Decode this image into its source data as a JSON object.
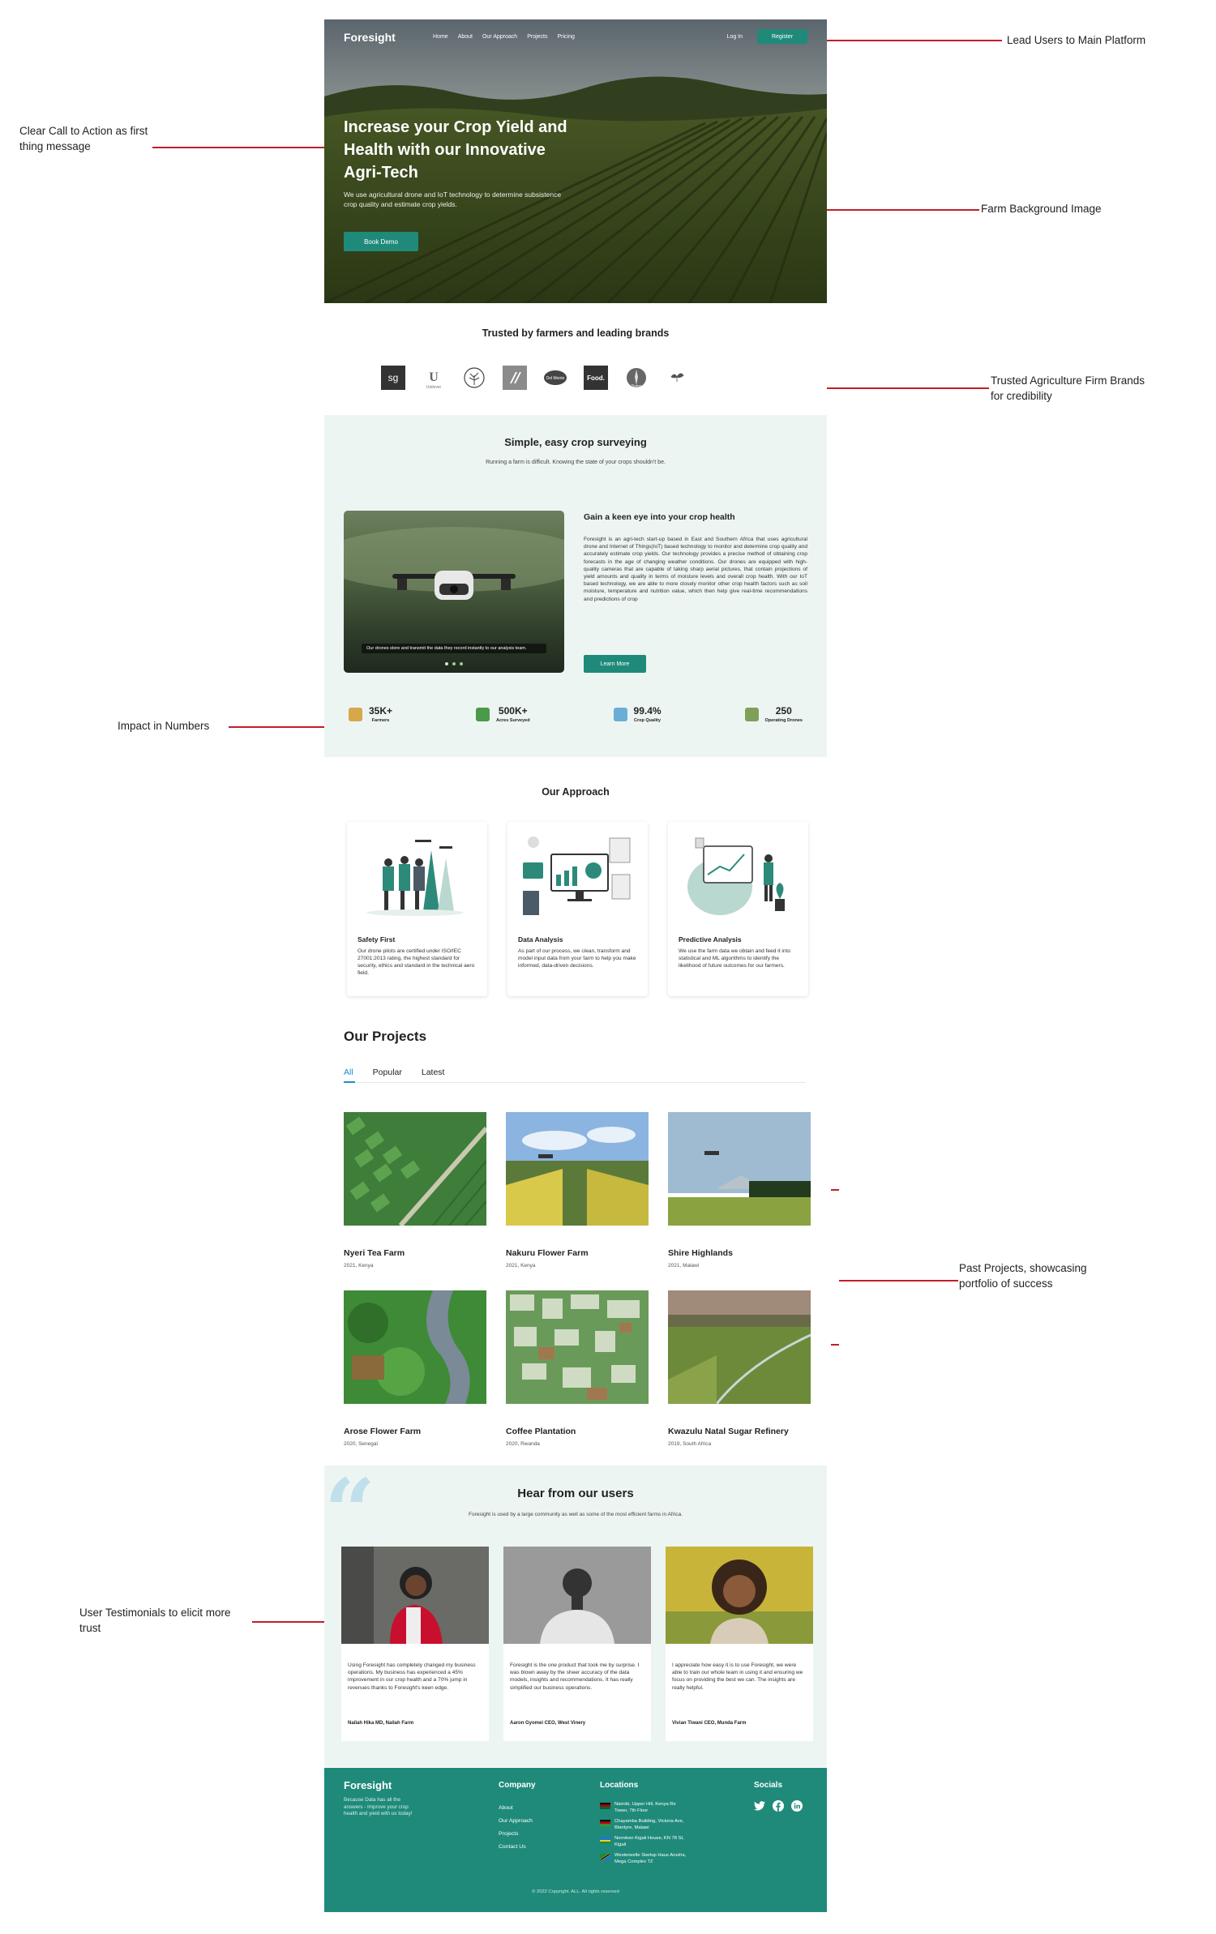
{
  "annotations": {
    "lead_users": "Lead Users to Main Platform",
    "cta_line1": "Clear Call to Action as first",
    "cta_line2": "thing message",
    "farm_bg": "Farm Background Image",
    "brands_line1": "Trusted Agriculture Firm Brands",
    "brands_line2": "for credibility",
    "impact": "Impact in Numbers",
    "past_line1": "Past Projects, showcasing",
    "past_line2": "portfolio of success",
    "testi_line1": "User Testimonials to elicit more",
    "testi_line2": "trust"
  },
  "nav": {
    "logo": "Foresight",
    "links": [
      "Home",
      "About",
      "Our Approach",
      "Projects",
      "Pricing"
    ],
    "login": "Log In",
    "register": "Register"
  },
  "hero": {
    "title": "Increase your Crop Yield and Health with our Innovative Agri-Tech",
    "text": "We use agricultural drone and IoT technology to determine subsistence crop quality and estimate crop yields.",
    "cta": "Book Demo"
  },
  "trusted": {
    "title": "Trusted by farmers and leading brands",
    "brands": [
      "sg",
      "Unilever",
      "tree",
      "brand-4",
      "Del Monte",
      "Food.",
      "Twiga",
      "leaf"
    ]
  },
  "survey": {
    "title": "Simple, easy crop surveying",
    "subtitle": "Running a farm is difficult. Knowing the state of your crops shouldn't be.",
    "caption": "Our drones store and transmit the data they record instantly to our analysis team.",
    "heading": "Gain a keen eye into your crop health",
    "body": "Foresight is an agri-tech start-up based in East and Southern Africa that uses agricultural drone and Internet of Things(IoT) based technology to monitor and determine crop quality and accurately estimate crop yields. Our technology provides a precise method of obtaining crop forecasts in the age of changing weather conditions. Our drones are equipped with high-quality cameras that are capable of taking sharp aerial pictures, that contain projections of yield amounts and quality in terms of moisture levels and overall crop health. With our IoT based technology, we are able to more closely monitor other crop health factors such as soil moisture, temperature and nutrition value, which then help give real-time recommendations and predictions of crop",
    "cta": "Learn More"
  },
  "stats": [
    {
      "value": "35K+",
      "label": "Farmers",
      "icon": "farmer-icon",
      "color": "#d7a84a"
    },
    {
      "value": "500K+",
      "label": "Acres Surveyed",
      "icon": "field-icon",
      "color": "#4a9a4a"
    },
    {
      "value": "99.4%",
      "label": "Crop Quality",
      "icon": "quality-icon",
      "color": "#6aaed6"
    },
    {
      "value": "250",
      "label": "Operating Drones",
      "icon": "drone-icon",
      "color": "#7fa05a"
    }
  ],
  "approach": {
    "title": "Our Approach",
    "cards": [
      {
        "title": "Safety First",
        "text": "Our drone pilots are certified under ISO/IEC 27001:2013 rating, the highest standard for security, ethics and standard in the technical aero field."
      },
      {
        "title": "Data Analysis",
        "text": "As part of our process, we clean, transform and model input data from your farm to help you make informed, data-driven decisions."
      },
      {
        "title": "Predictive Analysis",
        "text": "We use the farm data we obtain and feed it into statistical and ML algorithms to identify the likelihood of future outcomes for our farmers."
      }
    ]
  },
  "projects": {
    "title": "Our Projects",
    "tabs": [
      "All",
      "Popular",
      "Latest"
    ],
    "items": [
      {
        "name": "Nyeri Tea Farm",
        "meta": "2021, Kenya"
      },
      {
        "name": "Nakuru Flower Farm",
        "meta": "2021, Kenya"
      },
      {
        "name": "Shire Highlands",
        "meta": "2021, Malawi"
      },
      {
        "name": "Arose Flower Farm",
        "meta": "2020, Senegal"
      },
      {
        "name": "Coffee Plantation",
        "meta": "2020, Rwanda"
      },
      {
        "name": "Kwazulu Natal Sugar Refinery",
        "meta": "2019, South Africa"
      }
    ]
  },
  "users": {
    "title": "Hear from our users",
    "subtitle": "Foresight is used by a large community as well as some of the most efficient farms in Africa.",
    "items": [
      {
        "text": "Using Foresight has completely changed my business operations. My business has experienced a 45% improvement in our crop health and a 70% jump in revenues thanks to Foresight's keen edge.",
        "author": "Nailah Hika MD, Nailah Farm"
      },
      {
        "text": "Foresight is the one product that took me by surprise. I was blown away by the sheer accuracy of the data models, insights and recommendations. It has really simplified our business operations.",
        "author": "Aaron Gyomei CEO, West Vinery"
      },
      {
        "text": "I appreciate how easy it is to use Foresight, we were able to train our whole team in using it and ensuring we focus on providing the best we can. The insights are really helpful.",
        "author": "Vivian Tiwani CEO, Munda Farm"
      }
    ]
  },
  "footer": {
    "logo": "Foresight",
    "tagline": "Because Data has all the answers - Improve your crop health and yield with us today!",
    "company_title": "Company",
    "company_links": [
      "About",
      "Our Approach",
      "Projects",
      "Contact Us"
    ],
    "locations_title": "Locations",
    "locations": [
      "Nairobi, Upper Hill, Kenya Re Tower, 7th Floor",
      "Chayamba Building, Victoria Ave, Blantyre, Malawi",
      "Norrsken Kigali House, KN 78 St, Kigali",
      "Westerwelle Startup Haus Arusha, Mega Complex TZ"
    ],
    "socials_title": "Socials",
    "socials": [
      "twitter-icon",
      "facebook-icon",
      "linkedin-icon"
    ],
    "copyright": "© 2022 Copyright. ALL. All rights reserved"
  }
}
